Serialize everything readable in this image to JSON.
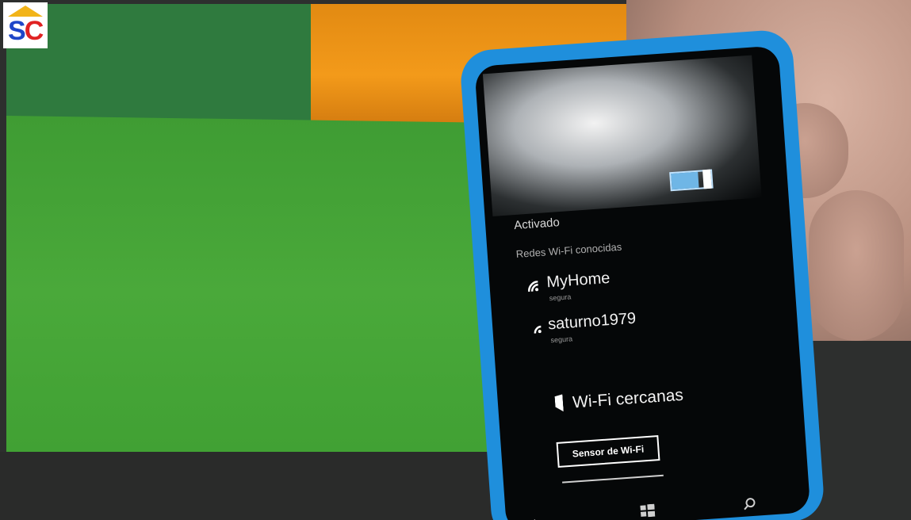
{
  "logo": {
    "letter1": "S",
    "letter2": "C"
  },
  "phone": {
    "status": "Activado",
    "section_label": "Redes Wi-Fi conocidas",
    "networks": [
      {
        "name": "MyHome",
        "sub": "segura"
      },
      {
        "name": "saturno1979",
        "sub": "segura"
      }
    ],
    "nearby_label": "Wi-Fi cercanas",
    "sensor_button": "Sensor de Wi-Fi",
    "toggle_on": true,
    "icons": {
      "back": "back-arrow-icon",
      "home": "windows-logo-icon",
      "search": "search-icon"
    }
  },
  "colors": {
    "phone_body": "#1f8fdc",
    "board_green": "#4aa93a",
    "orange": "#f39a1a",
    "logo_blue": "#1e46c8",
    "logo_red": "#e02222",
    "roof_yellow": "#f2b419"
  }
}
